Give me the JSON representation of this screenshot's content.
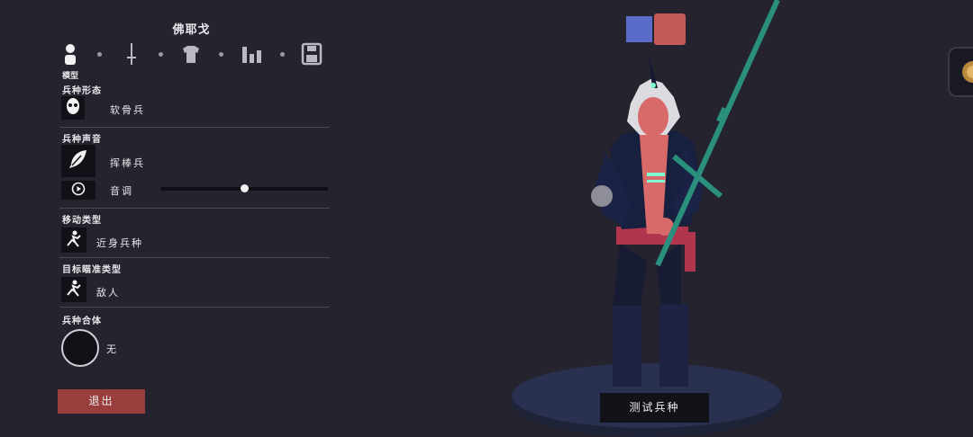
{
  "unit_name": "佛耶戈",
  "tabs": [
    {
      "icon": "person-icon",
      "caption": "模型"
    },
    {
      "icon": "sword-icon"
    },
    {
      "icon": "shirt-icon"
    },
    {
      "icon": "bar-chart-icon"
    },
    {
      "icon": "save-icon"
    }
  ],
  "sections": {
    "form": {
      "label": "兵种形态",
      "value": "软骨兵",
      "icon": "skull-face-icon"
    },
    "voice": {
      "label": "兵种声音",
      "value": "挥棒兵",
      "icon": "feather-icon",
      "pitch_label": "音调",
      "pitch_value": 0.5,
      "play_icon": "play-icon"
    },
    "movement": {
      "label": "移动类型",
      "value": "近身兵种",
      "icon": "melee-runner-icon"
    },
    "targeting": {
      "label": "目标瞄准类型",
      "value": "敌人",
      "icon": "melee-runner-icon"
    },
    "combo": {
      "label": "兵种合体",
      "value": "无"
    }
  },
  "exit_label": "退出",
  "test_label": "测试兵种",
  "team_colors": {
    "blue": "#5b6bc9",
    "red": "#c45a5a"
  },
  "accent": "#9a3d3d"
}
